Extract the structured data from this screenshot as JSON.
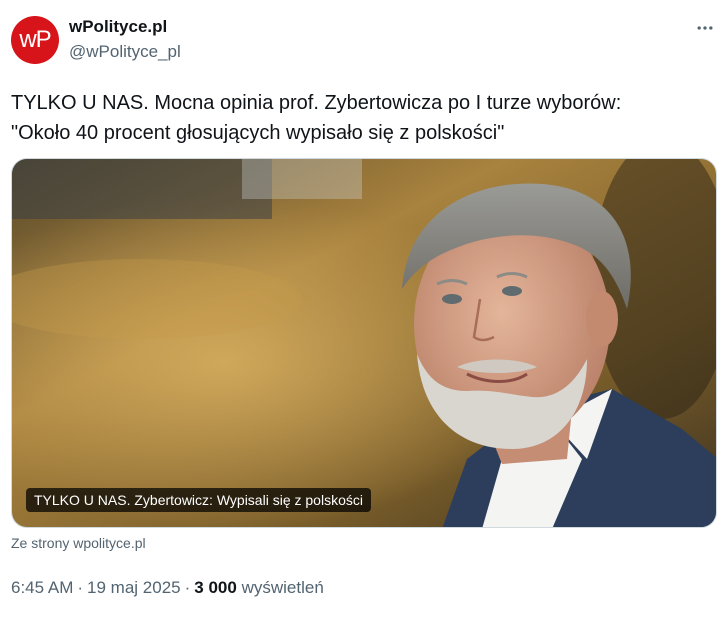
{
  "author": {
    "avatar_text": "wP",
    "display_name": "wPolityce.pl",
    "handle": "@wPolityce_pl"
  },
  "tweet": {
    "text": "TYLKO U NAS. Mocna opinia prof. Zybertowicza po I turze wyborów:\n\"Około 40 procent głosujących wypisało się z polskości\""
  },
  "card": {
    "caption": "TYLKO U NAS. Zybertowicz: Wypisali się z polskości",
    "source": "Ze strony wpolityce.pl"
  },
  "meta": {
    "time": "6:45 AM",
    "separator": "·",
    "date": "19 maj 2025",
    "views_count": "3 000",
    "views_label": "wyświetleń"
  },
  "colors": {
    "brand": "#d7141a",
    "text_primary": "#0f1419",
    "text_secondary": "#536471"
  },
  "icons": {
    "more": "more-horizontal-icon"
  }
}
